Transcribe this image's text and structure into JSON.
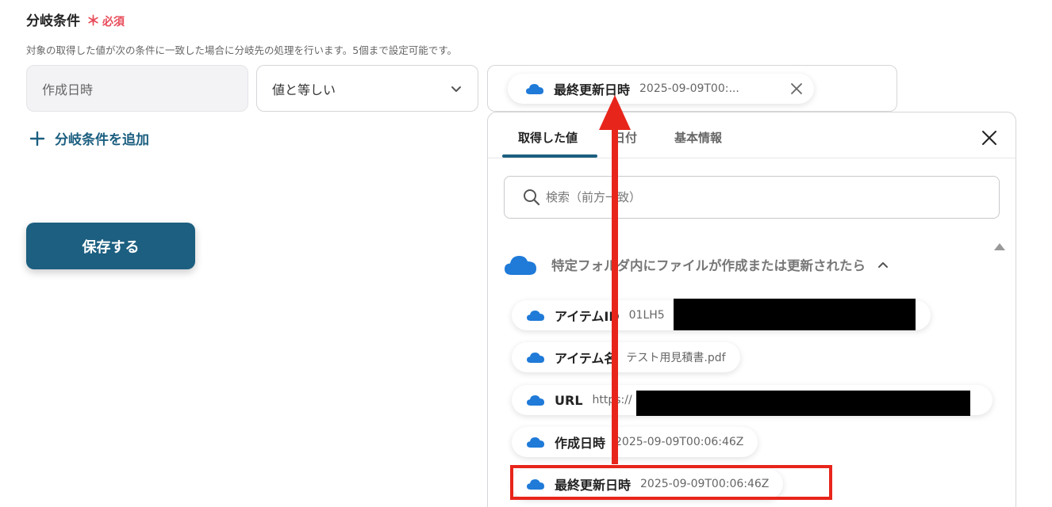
{
  "section": {
    "title": "分岐条件",
    "required_mark": "＊",
    "required_label": "必須",
    "description": "対象の取得した値が次の条件に一致した場合に分岐先の処理を行います。5個まで設定可能です。"
  },
  "condition": {
    "field_value": "作成日時",
    "operator_value": "値と等しい",
    "operand_chip": {
      "label": "最終更新日時",
      "value": "2025-09-09T00:..."
    }
  },
  "add_condition_label": "分岐条件を追加",
  "save_label": "保存する",
  "picker": {
    "tabs": [
      "取得した値",
      "日付",
      "基本情報"
    ],
    "active_tab": "取得した値",
    "search_placeholder": "検索（前方一致）",
    "group_title": "特定フォルダ内にファイルが作成または更新されたら",
    "items": [
      {
        "label": "アイテムID",
        "value": "01LH5"
      },
      {
        "label": "アイテム名",
        "value": "テスト用見積書.pdf"
      },
      {
        "label": "URL",
        "value": "https://"
      },
      {
        "label": "作成日時",
        "value": "2025-09-09T00:06:46Z"
      },
      {
        "label": "最終更新日時",
        "value": "2025-09-09T00:06:46Z"
      }
    ],
    "highlighted_item": "最終更新日時"
  },
  "colors": {
    "accent": "#1c5f80",
    "required": "#e84b59",
    "annotation": "#e8251b",
    "cloud": "#1f7ad8"
  },
  "icons": [
    "onedrive-cloud-icon",
    "chevron-down-icon",
    "close-icon",
    "plus-icon",
    "search-icon",
    "chevron-up-icon",
    "scroll-up-icon"
  ]
}
